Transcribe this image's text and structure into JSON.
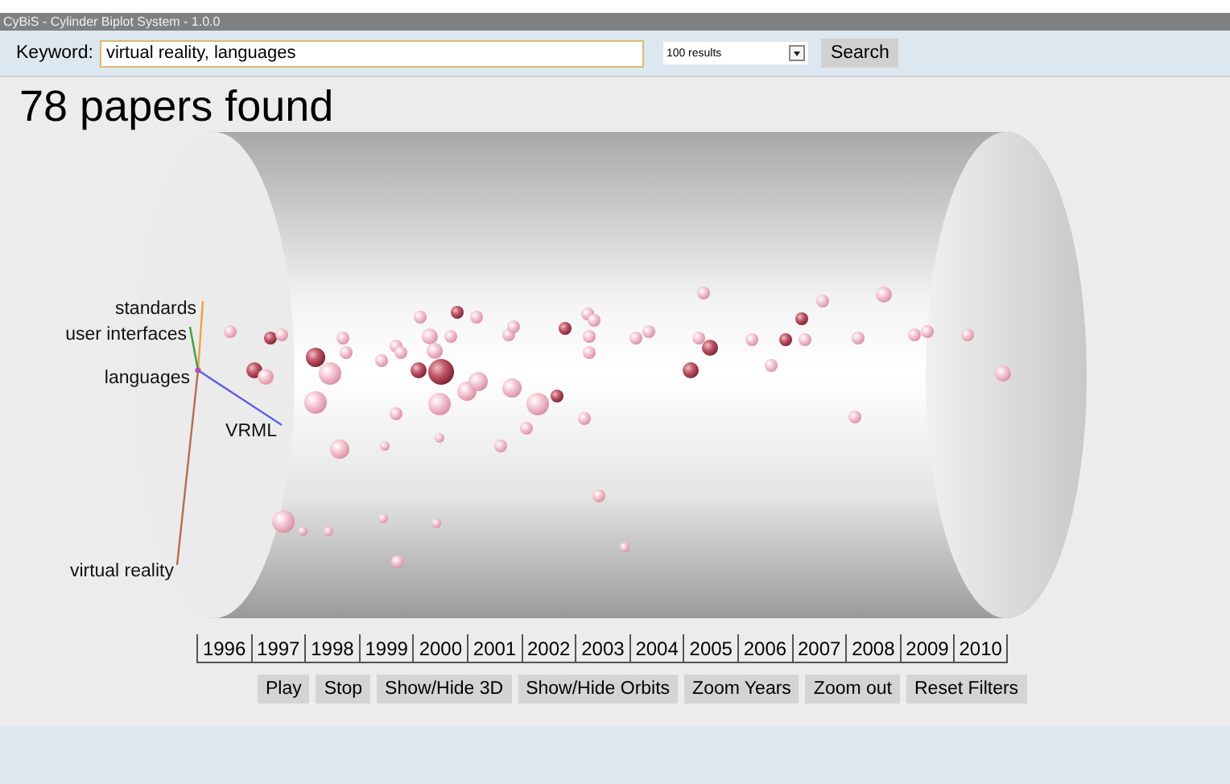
{
  "window": {
    "title": "CyBiS - Cylinder Biplot System - 1.0.0"
  },
  "search": {
    "label": "Keyword:",
    "value": "virtual reality, languages",
    "results": "100 results",
    "button": "Search"
  },
  "headline": "78 papers found",
  "terms": [
    {
      "label": "standards",
      "color": "#f0a040"
    },
    {
      "label": "user interfaces",
      "color": "#40a040"
    },
    {
      "label": "languages",
      "color": "#cc44cc"
    },
    {
      "label": "VRML",
      "color": "#6060e0"
    },
    {
      "label": "virtual reality",
      "color": "#b07050"
    }
  ],
  "years": [
    "1996",
    "1997",
    "1998",
    "1999",
    "2000",
    "2001",
    "2002",
    "2003",
    "2004",
    "2005",
    "2006",
    "2007",
    "2008",
    "2009",
    "2010"
  ],
  "buttons": [
    "Play",
    "Stop",
    "Show/Hide 3D",
    "Show/Hide Orbits",
    "Zoom Years",
    "Zoom out",
    "Reset Filters"
  ]
}
